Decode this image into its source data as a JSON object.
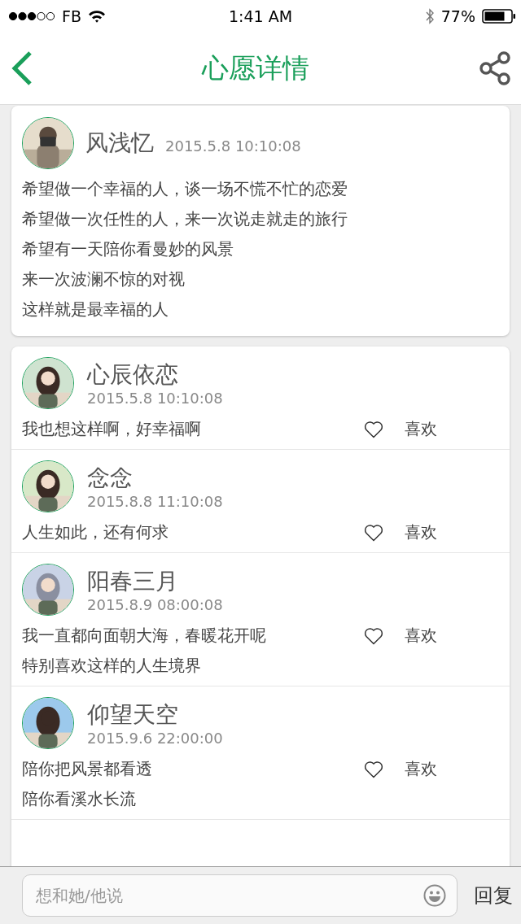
{
  "status_bar": {
    "carrier": "FB",
    "time": "1:41 AM",
    "battery": "77%"
  },
  "nav": {
    "title": "心愿详情"
  },
  "wish": {
    "name": "风浅忆",
    "time": "2015.5.8  10:10:08",
    "lines": [
      "希望做一个幸福的人，谈一场不慌不忙的恋爱",
      "希望做一次任性的人，来一次说走就走的旅行",
      "希望有一天陪你看曼妙的风景",
      "来一次波澜不惊的对视",
      "这样就是最幸福的人"
    ]
  },
  "comments": [
    {
      "name": "心辰依恋",
      "time": "2015.5.8  10:10:08",
      "lines": [
        "我也想这样啊，好幸福啊"
      ],
      "like": "喜欢"
    },
    {
      "name": "念念",
      "time": "2015.8.8  11:10:08",
      "lines": [
        "人生如此，还有何求"
      ],
      "like": "喜欢"
    },
    {
      "name": "阳春三月",
      "time": "2015.8.9  08:00:08",
      "lines": [
        "我一直都向面朝大海，春暖花开呢",
        "特别喜欢这样的人生境界"
      ],
      "like": "喜欢"
    },
    {
      "name": "仰望天空",
      "time": "2015.9.6  22:00:00",
      "lines": [
        "陪你把风景都看透",
        "陪你看溪水长流"
      ],
      "like": "喜欢"
    }
  ],
  "reply_bar": {
    "placeholder": "想和她/他说",
    "send": "回复"
  }
}
